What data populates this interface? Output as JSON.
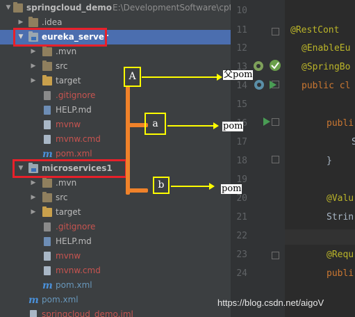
{
  "tree": {
    "root": {
      "name": "springcloud_demo",
      "path": "E:\\DevelopmentSoftware\\cptr"
    },
    "items": [
      {
        "label": ".idea"
      },
      {
        "label": "eureka_server"
      },
      {
        "label": ".mvn"
      },
      {
        "label": "src"
      },
      {
        "label": "target"
      },
      {
        "label": ".gitignore"
      },
      {
        "label": "HELP.md"
      },
      {
        "label": "mvnw"
      },
      {
        "label": "mvnw.cmd"
      },
      {
        "label": "pom.xml"
      },
      {
        "label": "microservices1"
      },
      {
        "label": ".mvn"
      },
      {
        "label": "src"
      },
      {
        "label": "target"
      },
      {
        "label": ".gitignore"
      },
      {
        "label": "HELP.md"
      },
      {
        "label": "mvnw"
      },
      {
        "label": "mvnw.cmd"
      },
      {
        "label": "pom.xml"
      },
      {
        "label": "pom.xml"
      },
      {
        "label": "springcloud_demo.iml"
      }
    ]
  },
  "gutter": {
    "line_numbers": [
      "10",
      "11",
      "12",
      "13",
      "14",
      "15",
      "16",
      "17",
      "18",
      "19",
      "20",
      "21",
      "22",
      "23",
      "24"
    ]
  },
  "editor": {
    "lines": [
      "@RestCont",
      "@EnableEu",
      "@SpringBo",
      "public cl",
      "publi",
      "S",
      "}",
      "@Valu",
      "Strin",
      "@Requ",
      "publi"
    ]
  },
  "annotations": {
    "box_A": "A",
    "box_a": "a",
    "box_b": "b",
    "arrow_A_label": "父pom",
    "arrow_a_label": "pom",
    "arrow_b_label": "pom"
  },
  "watermark": "https://blog.csdn.net/aigoV",
  "colors": {
    "highlight_red": "#e8202a",
    "annotation_yellow": "#ffff00",
    "bracket_orange": "#f0822a",
    "selection_blue": "#4b6eaf"
  }
}
